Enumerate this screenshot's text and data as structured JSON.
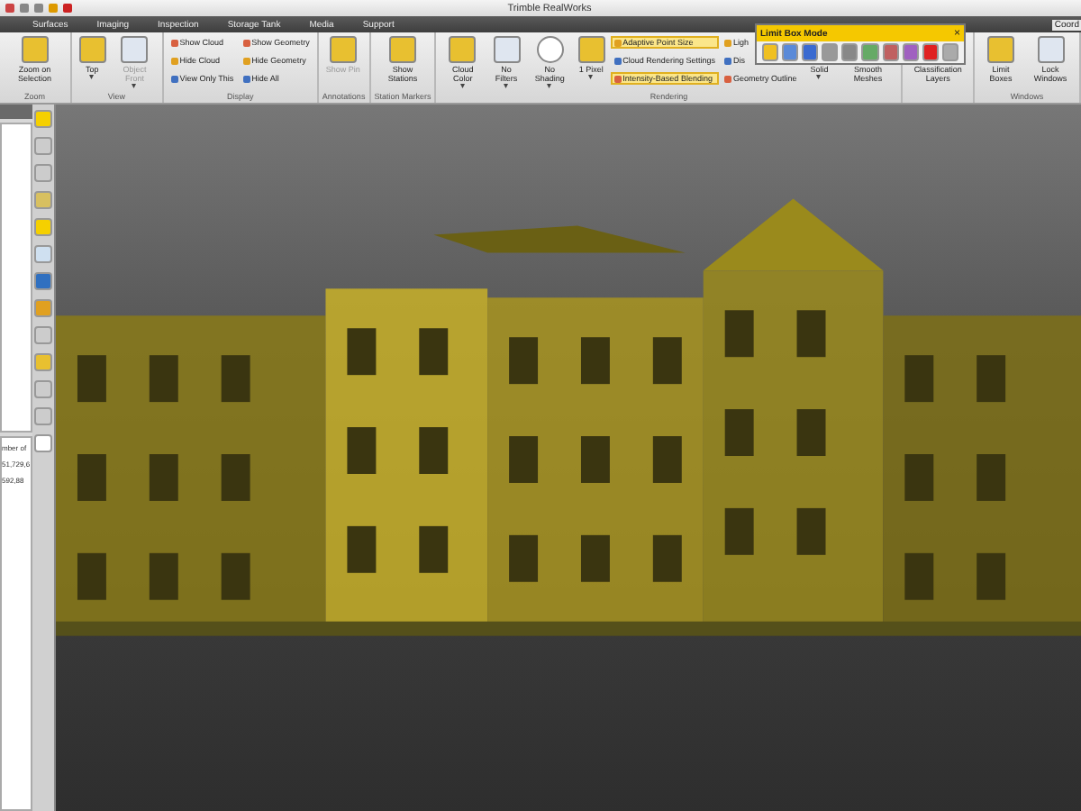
{
  "window": {
    "title": "Trimble RealWorks"
  },
  "tabs": [
    {
      "label": "Surfaces",
      "selected": false
    },
    {
      "label": "Imaging",
      "selected": false
    },
    {
      "label": "Inspection",
      "selected": false
    },
    {
      "label": "Storage Tank",
      "selected": false
    },
    {
      "label": "Media",
      "selected": false
    },
    {
      "label": "Support",
      "selected": false
    }
  ],
  "ribbon_edge_text": "Coord",
  "ribbon": [
    {
      "label": "Zoom",
      "items": [
        {
          "kind": "large",
          "label": "Zoom on Selection",
          "disabled": false,
          "highlighted": false
        }
      ]
    },
    {
      "label": "View",
      "items": [
        {
          "kind": "large",
          "label": "Top",
          "disabled": false,
          "highlighted": false,
          "caret": "▾"
        },
        {
          "kind": "large",
          "label": "Object Front",
          "disabled": true,
          "highlighted": false,
          "caret": "▾"
        }
      ]
    },
    {
      "label": "Display",
      "items": [
        {
          "kind": "small",
          "label": "Show Cloud",
          "disabled": false,
          "highlighted": false
        },
        {
          "kind": "small",
          "label": "Hide Cloud",
          "disabled": false,
          "highlighted": false
        },
        {
          "kind": "small",
          "label": "View Only This",
          "disabled": false,
          "highlighted": false
        },
        {
          "kind": "small",
          "label": "Show Geometry",
          "disabled": false,
          "highlighted": false
        },
        {
          "kind": "small",
          "label": "Hide Geometry",
          "disabled": false,
          "highlighted": false
        },
        {
          "kind": "small",
          "label": "Hide All",
          "disabled": false,
          "highlighted": false
        }
      ]
    },
    {
      "label": "Annotations",
      "items": [
        {
          "kind": "large",
          "label": "Show Pin",
          "disabled": true,
          "highlighted": false
        }
      ]
    },
    {
      "label": "Station Markers",
      "items": [
        {
          "kind": "large",
          "label": "Show Stations",
          "disabled": false,
          "highlighted": false
        }
      ]
    },
    {
      "label": "Rendering",
      "items": [
        {
          "kind": "large",
          "label": "Cloud Color",
          "disabled": false,
          "highlighted": false,
          "caret": "▾"
        },
        {
          "kind": "large",
          "label": "No Filters",
          "disabled": false,
          "highlighted": false,
          "caret": "▾"
        },
        {
          "kind": "large",
          "label": "No Shading",
          "disabled": false,
          "highlighted": false,
          "caret": "▾"
        },
        {
          "kind": "large",
          "label": "1 Pixel",
          "disabled": false,
          "highlighted": false,
          "caret": "▾"
        },
        {
          "kind": "small",
          "label": "Adaptive Point Size",
          "disabled": false,
          "highlighted": true
        },
        {
          "kind": "small",
          "label": "Cloud Rendering Settings",
          "disabled": false,
          "highlighted": false
        },
        {
          "kind": "small",
          "label": "Intensity-Based Blending",
          "disabled": false,
          "highlighted": true
        },
        {
          "kind": "small",
          "label": "Ligh",
          "disabled": false,
          "highlighted": false
        },
        {
          "kind": "small",
          "label": "Dis",
          "disabled": false,
          "highlighted": false
        },
        {
          "kind": "small",
          "label": "Geometry Outline",
          "disabled": false,
          "highlighted": false
        },
        {
          "kind": "large",
          "label": "Solid",
          "disabled": false,
          "highlighted": false,
          "caret": "▾"
        },
        {
          "kind": "large",
          "label": "Smooth Meshes",
          "disabled": false,
          "highlighted": false
        }
      ]
    },
    {
      "items": [
        {
          "kind": "large",
          "label": "Classification Layers",
          "disabled": false,
          "highlighted": false
        }
      ]
    },
    {
      "label": "Windows",
      "items": [
        {
          "kind": "large",
          "label": "Limit Boxes",
          "disabled": false,
          "highlighted": false
        },
        {
          "kind": "large",
          "label": "Lock Windows",
          "disabled": false,
          "highlighted": false
        }
      ]
    }
  ],
  "floating_toolbar": {
    "title": "Limit Box Mode",
    "close": "×"
  },
  "left_panel": {
    "lines": [
      "mber of",
      "51,729,6",
      "592,88"
    ]
  }
}
